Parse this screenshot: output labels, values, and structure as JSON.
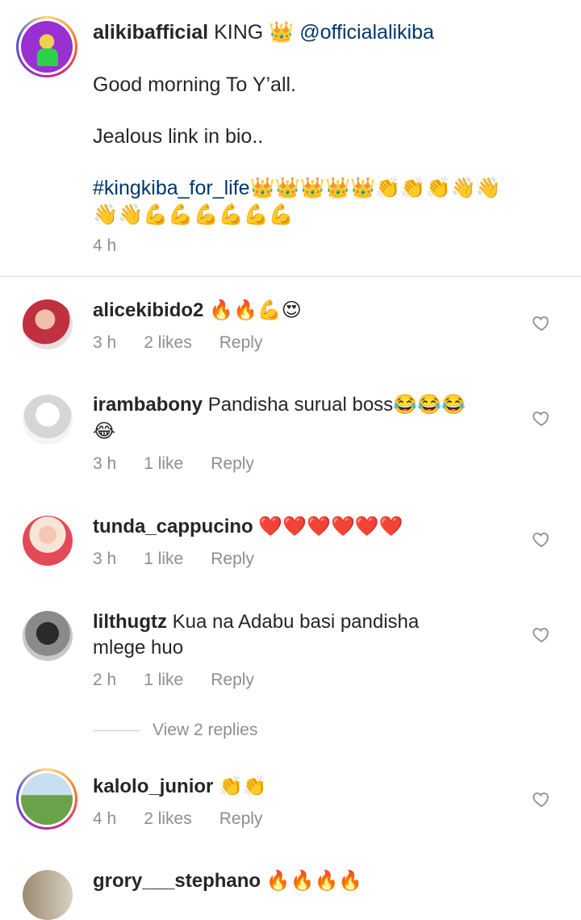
{
  "post": {
    "username": "alikibafficial",
    "text_king": "KING",
    "crown": "👑",
    "mention": "@officialalikiba",
    "line1": "Good morning To Y’all.",
    "line2": "Jealous link in bio..",
    "hashtag": "#kingkiba_for_life",
    "emoji_row1": "👑👑👑👑👑👏👏👏👋👋",
    "emoji_row2": "👋👋💪💪💪💪💪💪",
    "time": "4 h"
  },
  "comments": [
    {
      "username": "alicekibido2",
      "text": "🔥🔥💪😍",
      "time": "3 h",
      "likes": "2 likes",
      "reply": "Reply",
      "avatar_color": "#b8404a"
    },
    {
      "username": "irambabony",
      "text": "Pandisha surual boss😂😂😂",
      "text2": "😂",
      "time": "3 h",
      "likes": "1 like",
      "reply": "Reply",
      "avatar_color": "#cfcfcf"
    },
    {
      "username": "tunda_cappucino",
      "text": "❤️❤️❤️❤️❤️❤️",
      "time": "3 h",
      "likes": "1 like",
      "reply": "Reply",
      "avatar_color": "#e05560"
    },
    {
      "username": "lilthugtz",
      "text": "Kua na Adabu basi pandisha",
      "text2": "mlege huo",
      "time": "2 h",
      "likes": "1 like",
      "reply": "Reply",
      "avatar_color": "#505050",
      "view_replies": "View 2 replies"
    },
    {
      "username": "kalolo_junior",
      "text": "👏👏",
      "time": "4 h",
      "likes": "2 likes",
      "reply": "Reply",
      "avatar_color": "#6aa24a"
    },
    {
      "username": "grory___stephano",
      "text": "🔥🔥🔥🔥",
      "avatar_color": "#9a8a70"
    }
  ],
  "colors": {
    "link": "#00376b",
    "meta": "#8e8e8e",
    "fire": "#f26b1d",
    "heart_red": "#ed1c3a"
  }
}
